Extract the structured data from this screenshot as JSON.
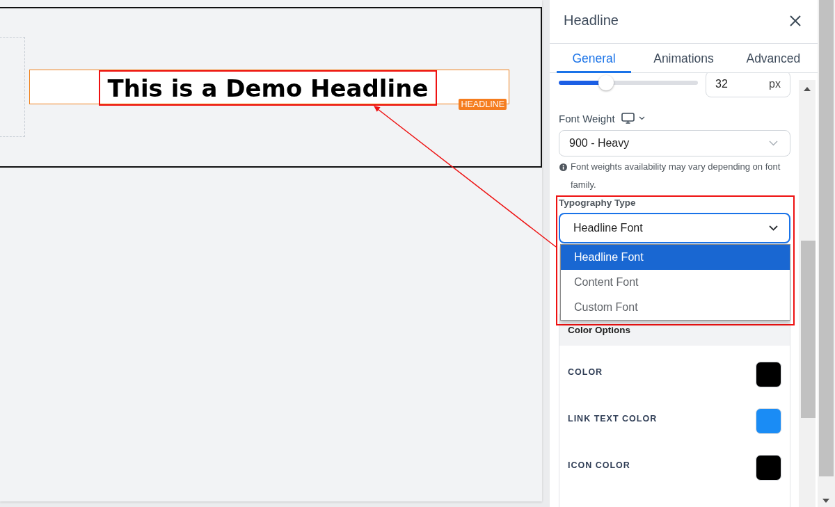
{
  "canvas": {
    "headline": "This is a Demo Headline",
    "block_label": "HEADLINE"
  },
  "panel": {
    "title": "Headline",
    "tabs": [
      {
        "label": "General",
        "selected": true
      },
      {
        "label": "Animations",
        "selected": false
      },
      {
        "label": "Advanced",
        "selected": false
      }
    ],
    "font_size": {
      "level": 0.34,
      "value": "32",
      "unit": "px"
    },
    "font_weight": {
      "label": "Font Weight",
      "value": "900 - Heavy"
    },
    "font_weight_note": "Font weights availability may vary depending on font family.",
    "typography_type": {
      "label": "Typography Type",
      "value": "Headline Font",
      "expanded": true,
      "options": [
        {
          "label": "Headline Font",
          "selected": true
        },
        {
          "label": "Content Font",
          "selected": false
        },
        {
          "label": "Custom Font",
          "selected": false
        }
      ]
    },
    "color_options": {
      "title": "Color Options",
      "items": [
        {
          "label": "COLOR",
          "color": "#000000"
        },
        {
          "label": "LINK TEXT COLOR",
          "color": "#1a8cf5"
        },
        {
          "label": "ICON COLOR",
          "color": "#000000"
        }
      ]
    }
  }
}
